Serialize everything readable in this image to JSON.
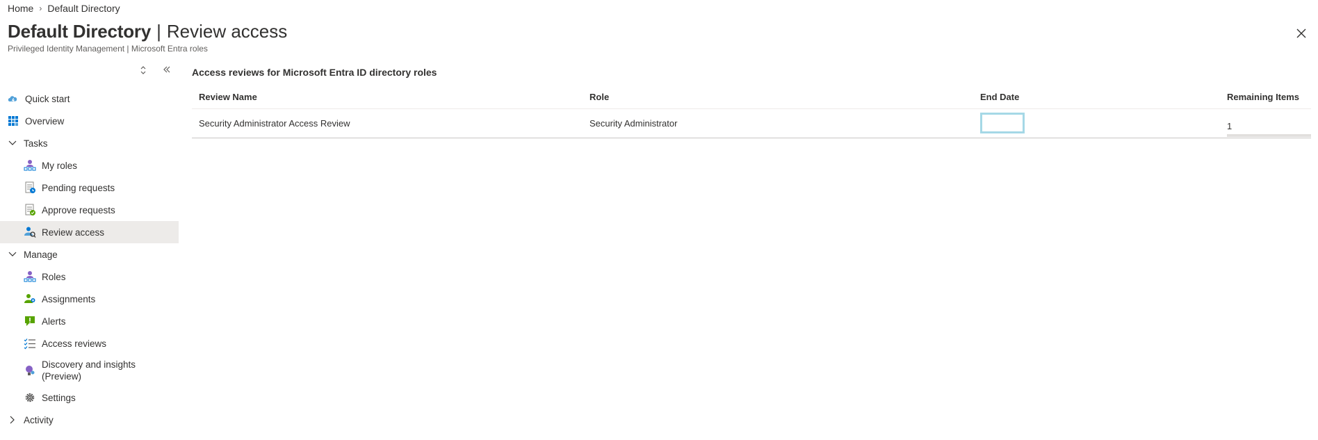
{
  "breadcrumb": {
    "home": "Home",
    "separator": "›",
    "current": "Default Directory"
  },
  "header": {
    "title": "Default Directory",
    "separator": "|",
    "page": "Review access",
    "more": "···",
    "subtitle": "Privileged Identity Management | Microsoft Entra roles"
  },
  "sidebar": {
    "items": [
      {
        "label": "Quick start",
        "icon": "cloud-lightning-icon"
      },
      {
        "label": "Overview",
        "icon": "grid-icon"
      },
      {
        "label": "Tasks",
        "icon": "chevron-down-icon"
      },
      {
        "label": "My roles",
        "icon": "user-roles-icon"
      },
      {
        "label": "Pending requests",
        "icon": "document-pending-icon"
      },
      {
        "label": "Approve requests",
        "icon": "document-approve-icon"
      },
      {
        "label": "Review access",
        "icon": "user-review-icon"
      },
      {
        "label": "Manage",
        "icon": "chevron-down-icon"
      },
      {
        "label": "Roles",
        "icon": "user-roles-icon"
      },
      {
        "label": "Assignments",
        "icon": "users-assign-icon"
      },
      {
        "label": "Alerts",
        "icon": "alert-icon"
      },
      {
        "label": "Access reviews",
        "icon": "checklist-icon"
      },
      {
        "label": "Discovery and insights",
        "label2": "(Preview)",
        "icon": "lightbulb-icon"
      },
      {
        "label": "Settings",
        "icon": "gear-icon"
      },
      {
        "label": "Activity",
        "icon": "chevron-right-icon"
      }
    ]
  },
  "main": {
    "section_title": "Access reviews for Microsoft Entra ID directory roles",
    "columns": [
      "Review Name",
      "Role",
      "End Date",
      "Remaining Items"
    ],
    "rows": [
      {
        "review_name": "Security Administrator Access Review",
        "role": "Security Administrator",
        "end_date": "",
        "remaining": "1"
      }
    ]
  },
  "colors": {
    "accent": "#0078d4",
    "active_bg": "#edebe9",
    "focus_border": "#a5d8e6"
  }
}
